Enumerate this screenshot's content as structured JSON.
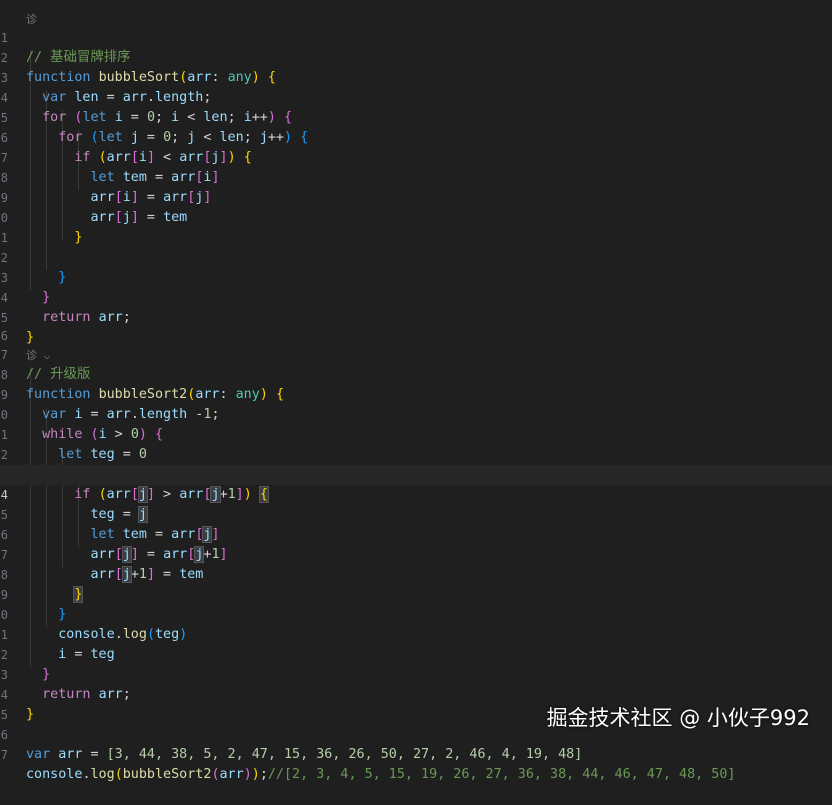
{
  "editor": {
    "codelens_1": "诊",
    "codelens_2": "诊",
    "line_numbers": [
      "1",
      "2",
      "3",
      "4",
      "5",
      "6",
      "7",
      "8",
      "9",
      "0",
      "1",
      "2",
      "3",
      "4",
      "5",
      "6",
      "7",
      "8",
      "9",
      "0",
      "1",
      "2",
      "3",
      "4",
      "5",
      "6",
      "7",
      "8",
      "9",
      "0",
      "1",
      "2",
      "3",
      "4",
      "5",
      "6",
      "7"
    ],
    "code": {
      "c1": "// 基础冒牌排序",
      "c2": "// 升级版",
      "kw_function": "function",
      "kw_var": "var",
      "kw_let": "let",
      "kw_for": "for",
      "kw_if": "if",
      "kw_while": "while",
      "kw_return": "return",
      "fn_bubbleSort": "bubbleSort",
      "fn_bubbleSort2": "bubbleSort2",
      "type_any": "any",
      "console": "console",
      "log": "log",
      "length": "length",
      "result_comment": "//[2, 3, 4, 5, 15, 19, 26, 27, 36, 38, 44, 46, 47, 48, 50]",
      "array_literal": "[3, 44, 38, 5, 2, 47, 15, 36, 26, 50, 27, 2, 46, 4, 19, 48]"
    }
  },
  "watermark": "掘金技术社区 @ 小伙子992"
}
